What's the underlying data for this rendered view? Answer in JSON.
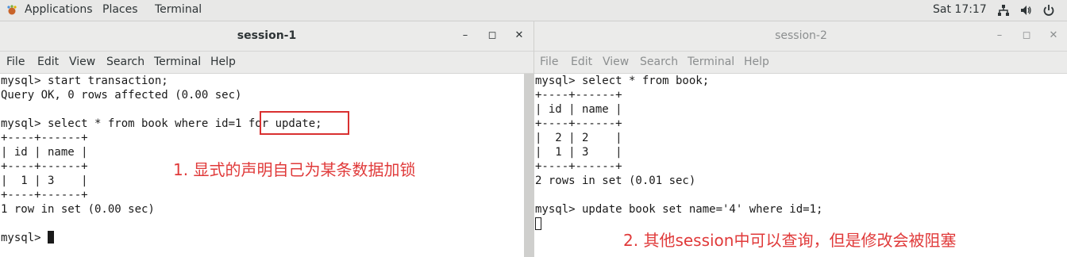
{
  "topbar": {
    "applications": "Applications",
    "places": "Places",
    "terminal": "Terminal",
    "clock": "Sat 17:17"
  },
  "left_window": {
    "title": "session-1",
    "menu": [
      "File",
      "Edit",
      "View",
      "Search",
      "Terminal",
      "Help"
    ],
    "lines": [
      "mysql> start transaction;",
      "Query OK, 0 rows affected (0.00 sec)",
      "",
      "mysql> select * from book where id=1 for update;",
      "+----+------+",
      "| id | name |",
      "+----+------+",
      "|  1 | 3    |",
      "+----+------+",
      "1 row in set (0.00 sec)",
      "",
      "mysql> "
    ],
    "annotation": "1. 显式的声明自己为某条数据加锁"
  },
  "right_window": {
    "title": "session-2",
    "menu": [
      "File",
      "Edit",
      "View",
      "Search",
      "Terminal",
      "Help"
    ],
    "lines": [
      "mysql> select * from book;",
      "+----+------+",
      "| id | name |",
      "+----+------+",
      "|  2 | 2    |",
      "|  1 | 3    |",
      "+----+------+",
      "2 rows in set (0.01 sec)",
      "",
      "mysql> update book set name='4' where id=1;"
    ],
    "annotation": "2. 其他session中可以查询，但是修改会被阻塞"
  },
  "colors": {
    "annotation_red": "#e03a3a",
    "highlight_box": "#d93030",
    "topbar_bg": "#e8e8e7",
    "titlebar_bg": "#ebebea"
  },
  "icons": {
    "apps": "gnome-foot-icon",
    "network": "network-icon",
    "volume": "volume-icon",
    "power": "power-icon"
  }
}
